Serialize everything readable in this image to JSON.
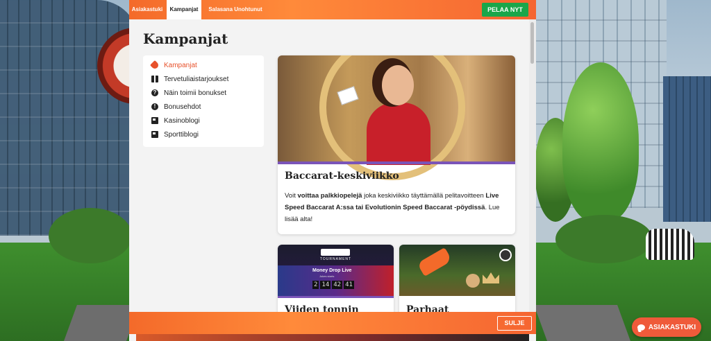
{
  "topbar": {
    "tabs": [
      {
        "label": "Asiakastuki",
        "active": false
      },
      {
        "label": "Kampanjat",
        "active": true
      },
      {
        "label": "Salasana Unohtunut",
        "active": false
      }
    ],
    "play_label": "PELAA NYT"
  },
  "page": {
    "title": "Kampanjat"
  },
  "sidebar": {
    "items": [
      {
        "label": "Kampanjat",
        "icon": "tag-icon",
        "active": true
      },
      {
        "label": "Tervetuliaistarjoukset",
        "icon": "gift-icon",
        "active": false
      },
      {
        "label": "Näin toimii bonukset",
        "icon": "question-icon",
        "active": false
      },
      {
        "label": "Bonusehdot",
        "icon": "exclamation-icon",
        "active": false
      },
      {
        "label": "Kasinoblogi",
        "icon": "newspaper-icon",
        "active": false
      },
      {
        "label": "Sporttiblogi",
        "icon": "newspaper-icon",
        "active": false
      }
    ]
  },
  "promo_main": {
    "title": "Baccarat-keskiviikko",
    "text_1": "Voit ",
    "text_2": "voittaa palkkiopelejä",
    "text_3": " joka keskiviikko täyttämällä pelitavoitteen ",
    "text_4": "Live Speed Baccarat A:ssa tai Evolutionin Speed Baccarat -pöydissä",
    "text_5": ". Lue lisää alta!"
  },
  "promo_small": [
    {
      "title": "Viiden tonnin",
      "image_tag": "TOURNAMENT",
      "game_name": "Money Drop Live",
      "game_sub": "Jokes starts",
      "timer": [
        "2",
        "14",
        "42",
        "41"
      ]
    },
    {
      "title": "Parhaat"
    }
  ],
  "footer": {
    "close_label": "SULJE"
  },
  "chat": {
    "label": "ASIAKASTUKI"
  },
  "colors": {
    "brand_orange": "#f46a2a",
    "play_green": "#1aa64a",
    "active_red": "#e7512b",
    "promo_stripe": "#7a54b8"
  }
}
